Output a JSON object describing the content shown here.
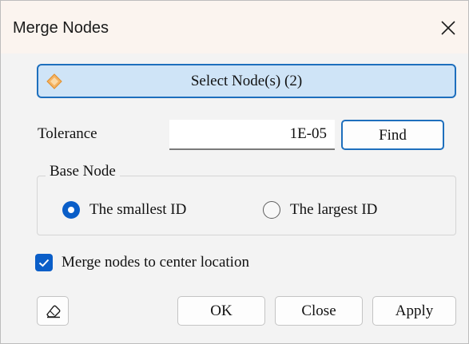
{
  "window": {
    "title": "Merge Nodes"
  },
  "select_button": {
    "label": "Select Node(s) (2)",
    "icon": "diamond-icon"
  },
  "tolerance": {
    "label": "Tolerance",
    "value": "1E-05",
    "find_label": "Find"
  },
  "base_node": {
    "title": "Base Node",
    "options": [
      {
        "label": "The smallest ID",
        "selected": true
      },
      {
        "label": "The largest ID",
        "selected": false
      }
    ]
  },
  "merge_center": {
    "label": "Merge nodes to center location",
    "checked": true
  },
  "buttons": {
    "eraser_icon": "eraser-icon",
    "ok": "OK",
    "close": "Close",
    "apply": "Apply"
  },
  "colors": {
    "accent": "#0a5ec8",
    "select_bg": "#cfe4f7",
    "select_border": "#1e6fbd",
    "title_bg": "#fbf4ef",
    "dialog_bg": "#f3f3f3",
    "diamond": "#f5b261"
  }
}
